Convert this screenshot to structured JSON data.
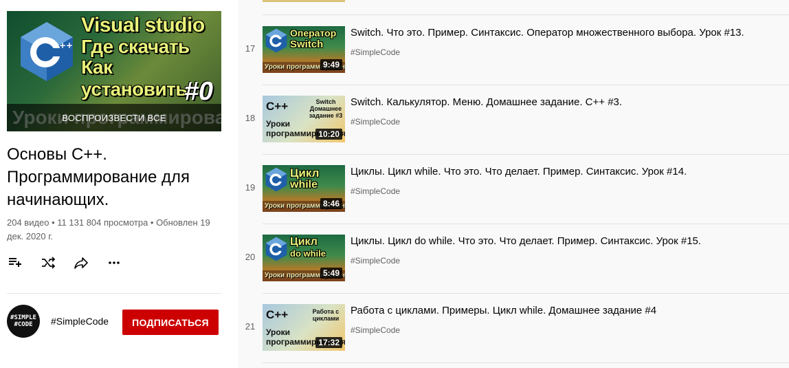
{
  "playlist": {
    "hero": {
      "line1": "Visual studio",
      "line2": "Где скачать",
      "line3": "Как установить",
      "number": "#0",
      "ghost_text": "Уроки программирования",
      "play_all": "ВОСПРОИЗВЕСТИ ВСЕ"
    },
    "title": "Основы C++. Программирование для начинающих.",
    "meta": "204 видео • 11 131 804 просмотра • Обновлен 19 дек. 2020 г.",
    "owner": {
      "avatar_line1": "#SIMPLE",
      "avatar_line2": "#CODE",
      "name": "#SimpleCode"
    },
    "subscribe_label": "ПОДПИСАТЬСЯ"
  },
  "icons": {
    "save": "playlist-add-icon",
    "shuffle": "shuffle-icon",
    "share": "share-icon",
    "more": "more-icon"
  },
  "colors": {
    "subscribe": "#cc0000",
    "background": "#f9f9f9",
    "secondary_text": "#606060"
  },
  "videos": [
    {
      "index": "17",
      "title": "Switch. Что это. Пример. Синтаксис. Оператор множественного выбора. Урок #13.",
      "channel": "#SimpleCode",
      "duration": "9:49",
      "thumb": {
        "l1": "Оператор",
        "l2": "Switch",
        "band": "Уроки программирования"
      }
    },
    {
      "index": "18",
      "title": "Switch. Калькулятор. Меню. Домашнее задание. C++ #3.",
      "channel": "#SimpleCode",
      "duration": "10:20",
      "thumb": {
        "cpp": "C++",
        "uroki": "Уроки программирования",
        "small": "Switch Домашнее задание #3"
      }
    },
    {
      "index": "19",
      "title": "Циклы. Цикл while. Что это. Что делает. Пример. Синтаксис. Урок #14.",
      "channel": "#SimpleCode",
      "duration": "8:46",
      "thumb": {
        "l1": "Цикл",
        "l2": "while",
        "band": "Уроки программирования"
      }
    },
    {
      "index": "20",
      "title": "Циклы. Цикл do while. Что это. Что делает. Пример. Синтаксис. Урок #15.",
      "channel": "#SimpleCode",
      "duration": "5:49",
      "thumb": {
        "l1": "Цикл",
        "l2": "do while",
        "band": "Уроки программирования"
      }
    },
    {
      "index": "21",
      "title": "Работа с циклами. Примеры. Цикл while. Домашнее задание #4",
      "channel": "#SimpleCode",
      "duration": "17:32",
      "thumb": {
        "cpp": "C++",
        "uroki": "Уроки программирования",
        "small": "Работа с циклами"
      }
    }
  ]
}
